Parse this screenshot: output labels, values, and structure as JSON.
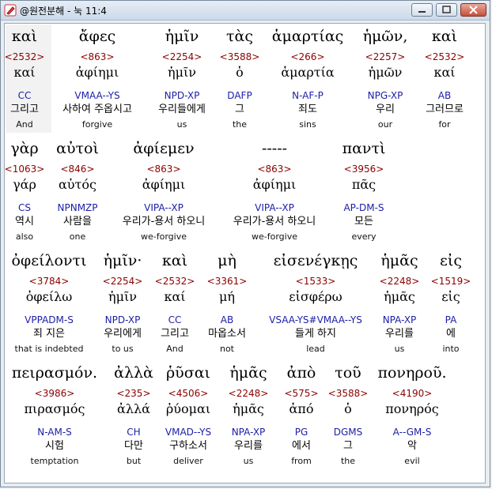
{
  "window": {
    "title": "@원전분해 - 눅 11:4",
    "app_icon": "app-pen-icon",
    "buttons": [
      "minimize-icon",
      "maximize-icon",
      "close-icon"
    ]
  },
  "rows": [
    [
      {
        "greek": "καὶ",
        "strong": "<2532>",
        "lemma": "καί",
        "parse": "CC",
        "korean": "그리고",
        "english": "And"
      },
      {
        "greek": "ἄφες",
        "strong": "<863>",
        "lemma": "ἀφίημι",
        "parse": "VMAA--YS",
        "korean": "사하여 주옵시고",
        "english": "forgive"
      },
      {
        "greek": "ἡμῖν",
        "strong": "<2254>",
        "lemma": "ἡμῖν",
        "parse": "NPD-XP",
        "korean": "우리들에게",
        "english": "us"
      },
      {
        "greek": "τὰς",
        "strong": "<3588>",
        "lemma": "ὁ",
        "parse": "DAFP",
        "korean": "그",
        "english": "the"
      },
      {
        "greek": "ἁμαρτίας",
        "strong": "<266>",
        "lemma": "ἁμαρτία",
        "parse": "N-AF-P",
        "korean": "죄도",
        "english": "sins"
      },
      {
        "greek": "ἡμῶν,",
        "strong": "<2257>",
        "lemma": "ἡμῶν",
        "parse": "NPG-XP",
        "korean": "우리",
        "english": "our"
      },
      {
        "greek": "καὶ",
        "strong": "<2532>",
        "lemma": "καί",
        "parse": "AB",
        "korean": "그러므로",
        "english": "for"
      }
    ],
    [
      {
        "greek": "γὰρ",
        "strong": "<1063>",
        "lemma": "γάρ",
        "parse": "CS",
        "korean": "역시",
        "english": "also"
      },
      {
        "greek": "αὐτοὶ",
        "strong": "<846>",
        "lemma": "αὐτός",
        "parse": "NPNMZP",
        "korean": "사람을",
        "english": "one"
      },
      {
        "greek": "ἀφίεμεν",
        "strong": "<863>",
        "lemma": "ἀφίημι",
        "parse": "VIPA--XP",
        "korean": "우리가-용서 하오니",
        "english": "we-forgive"
      },
      {
        "greek": "-----",
        "strong": "<863>",
        "lemma": "ἀφίημι",
        "parse": "VIPA--XP",
        "korean": "우리가-용서 하오니",
        "english": "we-forgive"
      },
      {
        "greek": "παντὶ",
        "strong": "<3956>",
        "lemma": "πᾶς",
        "parse": "AP-DM-S",
        "korean": "모든",
        "english": "every"
      }
    ],
    [
      {
        "greek": "ὀφείλοντι",
        "strong": "<3784>",
        "lemma": "ὀφείλω",
        "parse": "VPPADM-S",
        "korean": "죄 지은",
        "english": "that is indebted"
      },
      {
        "greek": "ἡμῖν·",
        "strong": "<2254>",
        "lemma": "ἡμῖν",
        "parse": "NPD-XP",
        "korean": "우리에게",
        "english": "to us"
      },
      {
        "greek": "καὶ",
        "strong": "<2532>",
        "lemma": "καί",
        "parse": "CC",
        "korean": "그리고",
        "english": "And"
      },
      {
        "greek": "μὴ",
        "strong": "<3361>",
        "lemma": "μή",
        "parse": "AB",
        "korean": "마옵소서",
        "english": "not"
      },
      {
        "greek": "εἰσενέγκῃς",
        "strong": "<1533>",
        "lemma": "εἰσφέρω",
        "parse": "VSAA-YS#VMAA--YS",
        "korean": "들게 하지",
        "english": "lead"
      },
      {
        "greek": "ἡμᾶς",
        "strong": "<2248>",
        "lemma": "ἡμᾶς",
        "parse": "NPA-XP",
        "korean": "우리를",
        "english": "us"
      },
      {
        "greek": "εἰς",
        "strong": "<1519>",
        "lemma": "εἰς",
        "parse": "PA",
        "korean": "에",
        "english": "into"
      }
    ],
    [
      {
        "greek": "πειρασμόν.",
        "strong": "<3986>",
        "lemma": "πιρασμός",
        "parse": "N-AM-S",
        "korean": "시험",
        "english": "temptation"
      },
      {
        "greek": "ἀλλὰ",
        "strong": "<235>",
        "lemma": "ἀλλά",
        "parse": "CH",
        "korean": "다만",
        "english": "but"
      },
      {
        "greek": "ῥῦσαι",
        "strong": "<4506>",
        "lemma": "ῥύομαι",
        "parse": "VMAD--YS",
        "korean": "구하소서",
        "english": "deliver"
      },
      {
        "greek": "ἡμᾶς",
        "strong": "<2248>",
        "lemma": "ἡμᾶς",
        "parse": "NPA-XP",
        "korean": "우리를",
        "english": "us"
      },
      {
        "greek": "ἀπὸ",
        "strong": "<575>",
        "lemma": "ἀπό",
        "parse": "PG",
        "korean": "에서",
        "english": "from"
      },
      {
        "greek": "τοῦ",
        "strong": "<3588>",
        "lemma": "ὁ",
        "parse": "DGMS",
        "korean": "그",
        "english": "the"
      },
      {
        "greek": "πονηροῦ.",
        "strong": "<4190>",
        "lemma": "πονηρός",
        "parse": "A--GM-S",
        "korean": "악",
        "english": "evil"
      }
    ]
  ]
}
